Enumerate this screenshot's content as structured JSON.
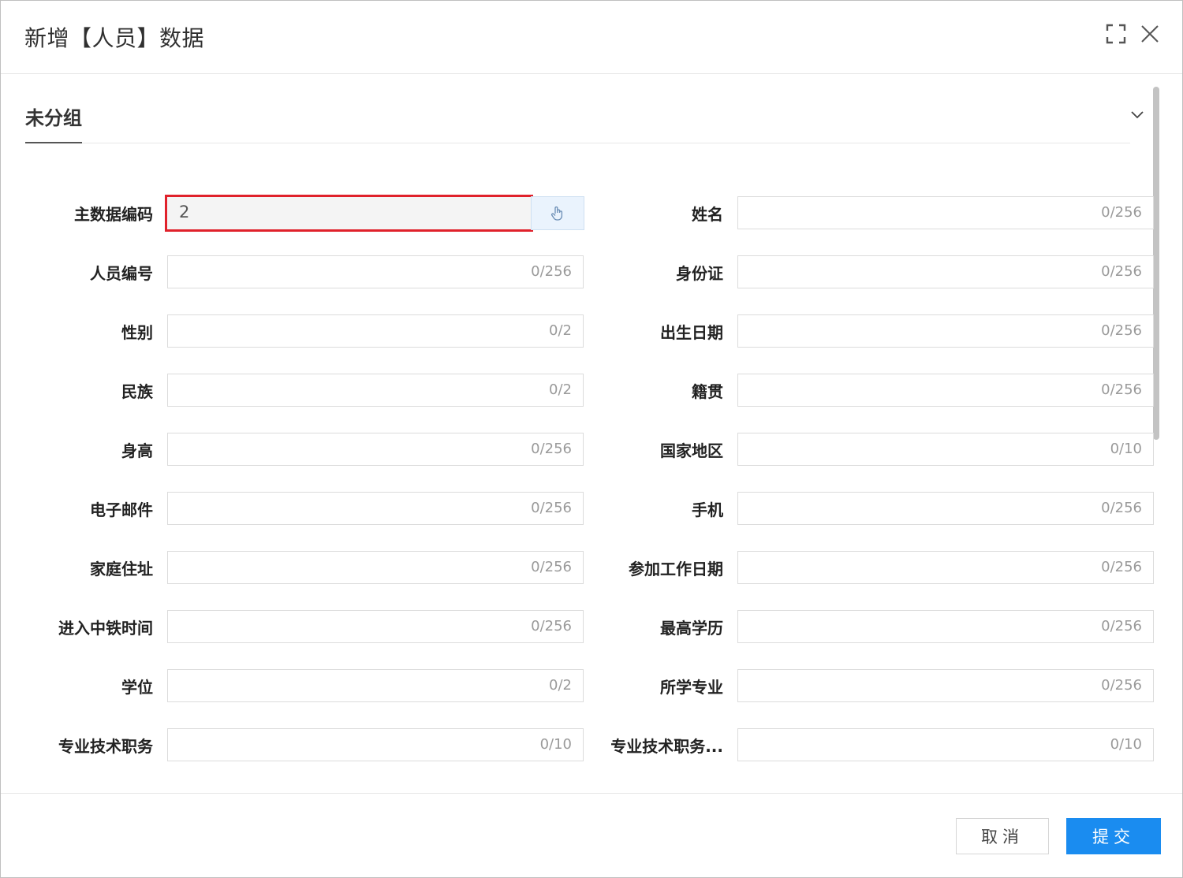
{
  "dialog": {
    "title": "新增【人员】数据"
  },
  "group": {
    "title": "未分组"
  },
  "primary_field": {
    "label": "主数据编码",
    "value": "2"
  },
  "fields_left": [
    {
      "label": "人员编号",
      "counter": "0/256"
    },
    {
      "label": "性别",
      "counter": "0/2"
    },
    {
      "label": "民族",
      "counter": "0/2"
    },
    {
      "label": "身高",
      "counter": "0/256"
    },
    {
      "label": "电子邮件",
      "counter": "0/256"
    },
    {
      "label": "家庭住址",
      "counter": "0/256"
    },
    {
      "label": "进入中铁时间",
      "counter": "0/256"
    },
    {
      "label": "学位",
      "counter": "0/2"
    },
    {
      "label": "专业技术职务",
      "counter": "0/10"
    }
  ],
  "fields_right": [
    {
      "label": "姓名",
      "counter": "0/256"
    },
    {
      "label": "身份证",
      "counter": "0/256"
    },
    {
      "label": "出生日期",
      "counter": "0/256"
    },
    {
      "label": "籍贯",
      "counter": "0/256"
    },
    {
      "label": "国家地区",
      "counter": "0/10"
    },
    {
      "label": "手机",
      "counter": "0/256"
    },
    {
      "label": "参加工作日期",
      "counter": "0/256"
    },
    {
      "label": "最高学历",
      "counter": "0/256"
    },
    {
      "label": "所学专业",
      "counter": "0/256"
    },
    {
      "label": "专业技术职务...",
      "counter": "0/10"
    }
  ],
  "footer": {
    "cancel_label": "取消",
    "submit_label": "提交"
  },
  "icons": {
    "maximize": "maximize-icon",
    "close": "close-icon",
    "collapse": "chevron-down-icon",
    "pick": "pointer-hand-icon"
  },
  "colors": {
    "accent": "#1a8cf0",
    "highlight_border": "#e0212b"
  }
}
